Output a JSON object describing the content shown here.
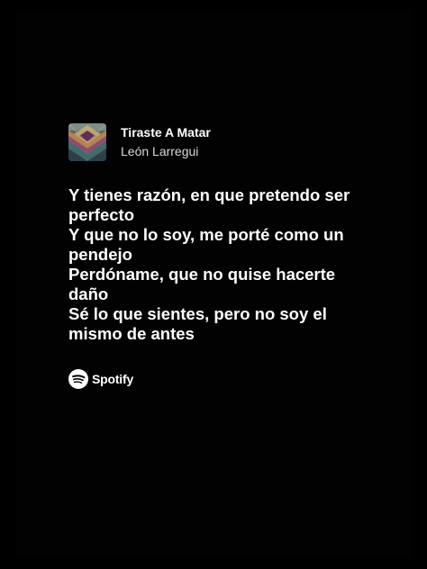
{
  "track": {
    "title": "Tiraste A Matar",
    "artist": "León Larregui"
  },
  "lyrics": [
    "Y tienes razón, en que pretendo ser",
    "perfecto",
    "Y que no lo soy, me porté como un",
    "pendejo",
    "Perdóname, que no quise hacerte",
    "daño",
    "Sé lo que sientes, pero no soy el",
    "mismo de antes"
  ],
  "brand": {
    "name": "Spotify",
    "icon": "spotify-logo-icon"
  },
  "colors": {
    "background": "#000000",
    "text": "#ffffff",
    "secondary_text": "#d9d9d9"
  }
}
